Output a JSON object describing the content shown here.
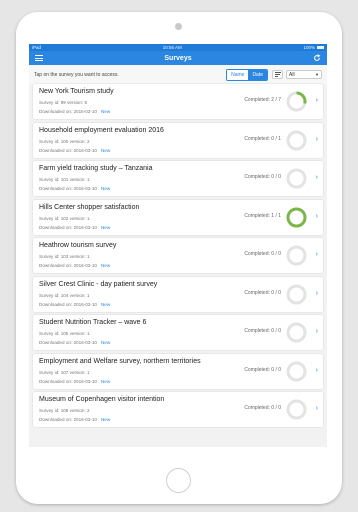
{
  "status": {
    "left": "iPad",
    "time": "10:56 AM",
    "battery": "100%"
  },
  "nav": {
    "title": "Surveys"
  },
  "toolbar": {
    "hint": "Tap on the survey you want to access.",
    "sort_name": "Name",
    "sort_date": "Date",
    "filter_value": "All"
  },
  "colors": {
    "accent": "#2a86e0",
    "ring_done": "#7ab648",
    "ring_empty": "#e3e3e3"
  },
  "surveys": [
    {
      "name": "New York Tourism study",
      "ids": "Survey id: 99  version: 5",
      "downloaded": "Downloaded on: 2016-03-10",
      "badge": "New",
      "completed": "Completed: 2 / 7",
      "progress": 0.2857
    },
    {
      "name": "Household employment evaluation 2016",
      "ids": "Survey id: 100  version: 2",
      "downloaded": "Downloaded on: 2016-03-10",
      "badge": "New",
      "completed": "Completed: 0 / 1",
      "progress": 0
    },
    {
      "name": "Farm yield tracking study – Tanzania",
      "ids": "Survey id: 101  version: 1",
      "downloaded": "Downloaded on: 2016-03-10",
      "badge": "New",
      "completed": "Completed: 0 / 0",
      "progress": 0
    },
    {
      "name": "Hills Center shopper satisfaction",
      "ids": "Survey id: 102  version: 1",
      "downloaded": "Downloaded on: 2016-03-10",
      "badge": "New",
      "completed": "Completed: 1 / 1",
      "progress": 1
    },
    {
      "name": "Heathrow tourism survey",
      "ids": "Survey id: 103  version: 1",
      "downloaded": "Downloaded on: 2016-03-10",
      "badge": "New",
      "completed": "Completed: 0 / 0",
      "progress": 0
    },
    {
      "name": "Silver Crest Clinic - day patient survey",
      "ids": "Survey id: 104  version: 1",
      "downloaded": "Downloaded on: 2016-03-10",
      "badge": "New",
      "completed": "Completed: 0 / 0",
      "progress": 0
    },
    {
      "name": "Student Nutrition Tracker – wave 6",
      "ids": "Survey id: 105  version: 1",
      "downloaded": "Downloaded on: 2016-03-10",
      "badge": "New",
      "completed": "Completed: 0 / 0",
      "progress": 0
    },
    {
      "name": "Employment and Welfare survey, northern territories",
      "ids": "Survey id: 107  version: 1",
      "downloaded": "Downloaded on: 2016-03-10",
      "badge": "New",
      "completed": "Completed: 0 / 0",
      "progress": 0
    },
    {
      "name": "Museum of Copenhagen visitor intention",
      "ids": "Survey id: 108  version: 2",
      "downloaded": "Downloaded on: 2016-03-10",
      "badge": "New",
      "completed": "Completed: 0 / 0",
      "progress": 0
    }
  ]
}
